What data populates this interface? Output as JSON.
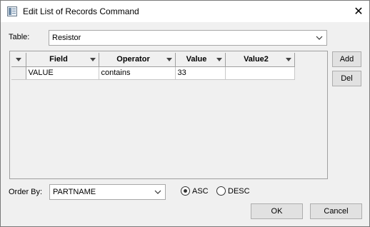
{
  "window": {
    "title": "Edit List of Records Command",
    "close_glyph": "✕"
  },
  "table_field": {
    "label": "Table:",
    "value": "Resistor"
  },
  "grid": {
    "columns": [
      "Field",
      "Operator",
      "Value",
      "Value2"
    ],
    "rows": [
      {
        "field": "VALUE",
        "operator": "contains",
        "value": "33",
        "value2": ""
      }
    ]
  },
  "side_buttons": {
    "add_label": "Add",
    "del_label": "Del"
  },
  "order_by": {
    "label": "Order By:",
    "value": "PARTNAME",
    "options": [
      "ASC",
      "DESC"
    ],
    "selected": "ASC"
  },
  "footer": {
    "ok_label": "OK",
    "cancel_label": "Cancel"
  },
  "icons": [
    "app-icon",
    "close-icon",
    "chevron-down-icon",
    "sort-arrow-icon"
  ]
}
